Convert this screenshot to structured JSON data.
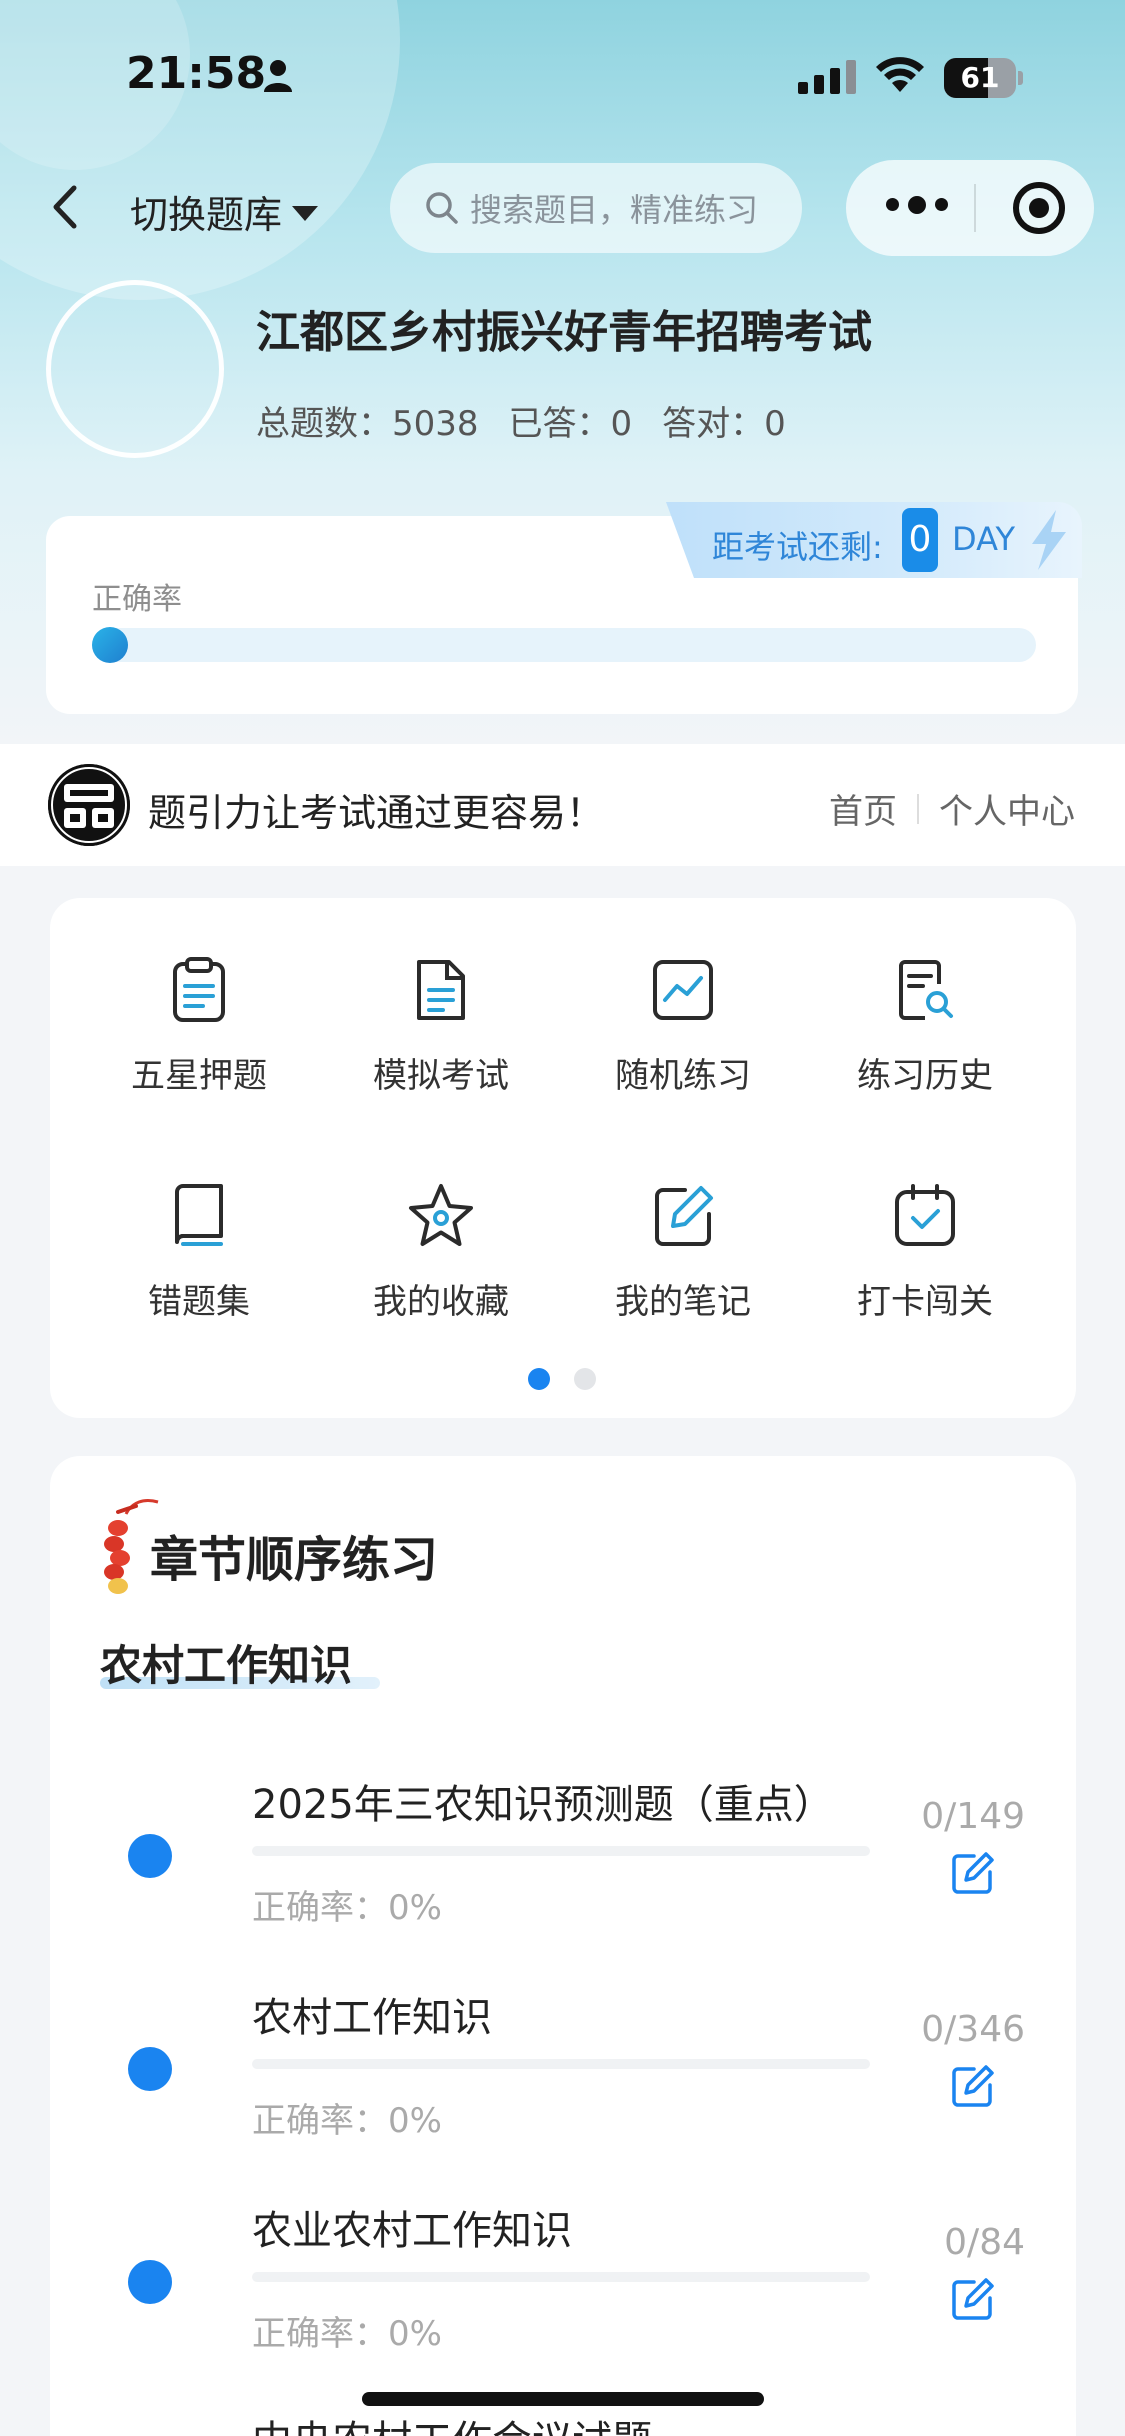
{
  "status_bar": {
    "time": "21:58",
    "battery": "61",
    "battery_level": 0.61
  },
  "nav": {
    "switch_label": "切换题库",
    "search_placeholder": "搜索题目，精准练习"
  },
  "profile": {
    "exam_title": "江都区乡村振兴好青年招聘考试",
    "total": "总题数：5038",
    "answered": "已答：0",
    "correct": "答对：0"
  },
  "accuracy": {
    "label": "正确率",
    "value": 0,
    "countdown_label": "距考试还剩:",
    "countdown_days": "0",
    "countdown_unit": "DAY"
  },
  "brand": {
    "logo_text": "题引力",
    "slogan": "题引力让考试通过更容易！",
    "links": [
      "首页",
      "个人中心"
    ]
  },
  "menu": {
    "items": [
      {
        "label": "五星押题",
        "icon": "clipboard-icon"
      },
      {
        "label": "模拟考试",
        "icon": "document-icon"
      },
      {
        "label": "随机练习",
        "icon": "trend-chart-icon"
      },
      {
        "label": "练习历史",
        "icon": "history-search-icon"
      },
      {
        "label": "错题集",
        "icon": "book-icon"
      },
      {
        "label": "我的收藏",
        "icon": "star-icon"
      },
      {
        "label": "我的笔记",
        "icon": "edit-note-icon"
      },
      {
        "label": "打卡闯关",
        "icon": "calendar-check-icon"
      }
    ],
    "pages": 2,
    "current_page": 1
  },
  "chapter": {
    "title": "章节顺序练习",
    "section": "农村工作知识",
    "items": [
      {
        "name": "2025年三农知识预测题（重点）",
        "rate": "正确率：0%",
        "count": "0/149"
      },
      {
        "name": "农村工作知识",
        "rate": "正确率：0%",
        "count": "0/346"
      },
      {
        "name": "农业农村工作知识",
        "rate": "正确率：0%",
        "count": "0/84"
      }
    ],
    "partial_item": "中央农村工作会议试题"
  },
  "colors": {
    "accent": "#1a84f0",
    "icon_teal": "#2aa0d6",
    "icon_dark": "#2b2b2b",
    "countdown_text": "#2f86d8"
  }
}
